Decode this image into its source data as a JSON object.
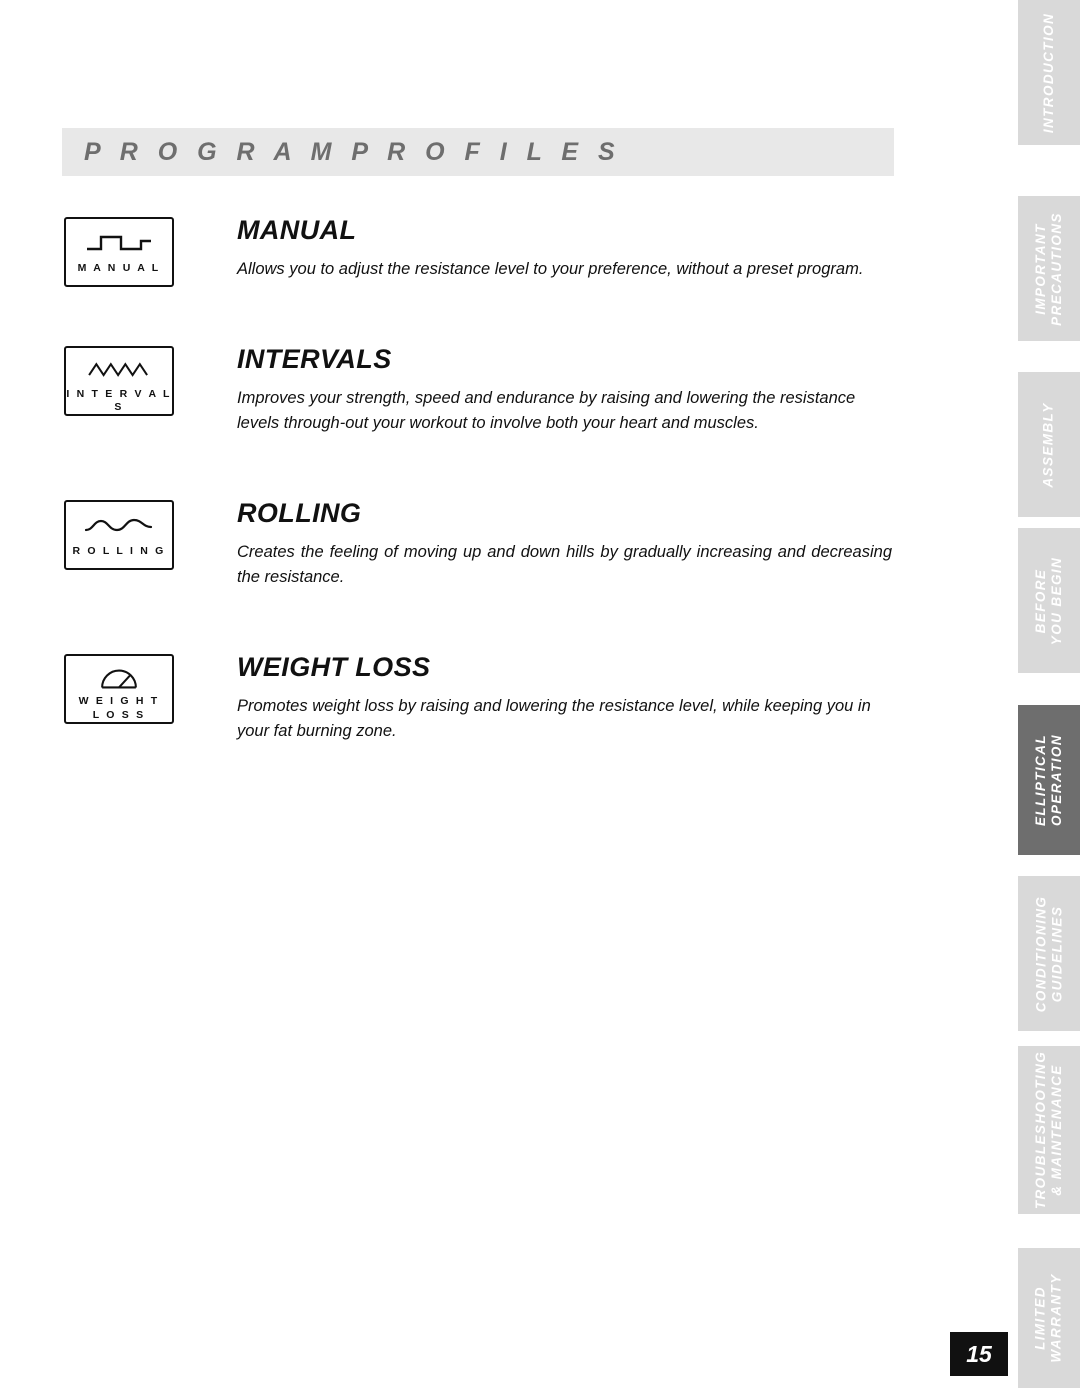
{
  "page": {
    "title": "P R O G R A M   P R O F I L E S",
    "number": "15"
  },
  "programs": [
    {
      "icon_label": "M A N U A L",
      "icon_name": "manual-profile-icon",
      "heading": "MANUAL",
      "description": "Allows you to adjust the resistance level to your preference, without a preset program."
    },
    {
      "icon_label": "I N T E R V A L S",
      "icon_name": "intervals-profile-icon",
      "heading": "INTERVALS",
      "description": "Improves your strength, speed and endurance by raising and lowering the resistance levels through-out your workout to involve both your heart and muscles."
    },
    {
      "icon_label": "R O L L I N G",
      "icon_name": "rolling-profile-icon",
      "heading": "ROLLING",
      "description": "Creates the feeling of moving up and down hills by gradually increasing and decreasing the resistance."
    },
    {
      "icon_label_line1": "W E I G H T",
      "icon_label_line2": "L O S S",
      "icon_name": "weight-loss-profile-icon",
      "heading": "WEIGHT LOSS",
      "description": "Promotes weight loss by raising and lowering the resistance level, while keeping you in your fat burning zone."
    }
  ],
  "side_tabs": [
    {
      "label": "INTRODUCTION",
      "active": false
    },
    {
      "label_line1": "IMPORTANT",
      "label_line2": "PRECAUTIONS",
      "active": false
    },
    {
      "label": "ASSEMBLY",
      "active": false
    },
    {
      "label_line1": "BEFORE",
      "label_line2": "YOU BEGIN",
      "active": false
    },
    {
      "label_line1": "ELLIPTICAL",
      "label_line2": "OPERATION",
      "active": true
    },
    {
      "label_line1": "CONDITIONING",
      "label_line2": "GUIDELINES",
      "active": false
    },
    {
      "label_line1": "TROUBLESHOOTING",
      "label_line2": "& MAINTENANCE",
      "active": false
    },
    {
      "label_line1": "LIMITED",
      "label_line2": "WARRANTY",
      "active": false
    }
  ],
  "colors": {
    "tab_inactive": "#d9d9d9",
    "tab_active": "#6e6e6e",
    "title_bar": "#e8e8e8",
    "title_text": "#6e6e6e",
    "page_number_bg": "#111111"
  }
}
